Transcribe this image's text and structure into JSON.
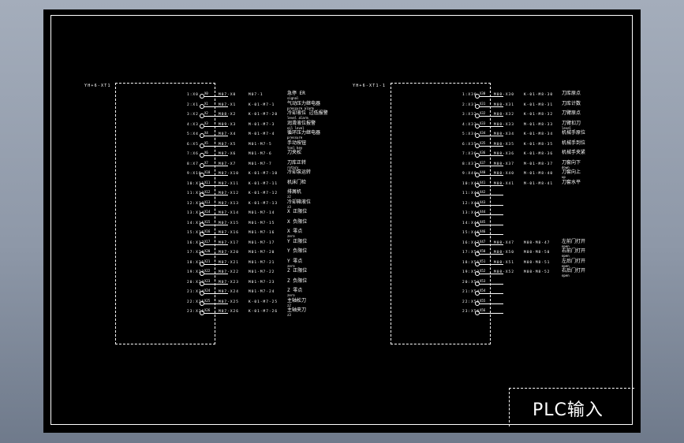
{
  "title_block": {
    "label": "PLC输入"
  },
  "left_panel": {
    "title": "YH+6-XT1",
    "rows": [
      {
        "t": "1:X0",
        "p": "X0",
        "a": "M07-X0",
        "c": "M07-1",
        "d": "急停 ER",
        "d2": "signal"
      },
      {
        "t": "2:X1",
        "p": "X1",
        "a": "M07-X1",
        "c": "K-01-M7-1",
        "d": "气动压力继电器",
        "d2": "pressure alarm"
      },
      {
        "t": "3:X2",
        "p": "X2",
        "a": "M08-X2",
        "c": "K-01-M7-20",
        "d": "冷却液位 过低报警",
        "d2": "level alarm"
      },
      {
        "t": "4:X3",
        "p": "X3",
        "a": "M09-X3",
        "c": "M-01-M7-3",
        "d": "润滑液位报警",
        "d2": "oil level"
      },
      {
        "t": "5:X4",
        "p": "X4",
        "a": "M07-X4",
        "c": "M-01-M7-4",
        "d": "循环压力继电器",
        "d2": "pressure"
      },
      {
        "t": "6:X5",
        "p": "X5",
        "a": "M07-X5",
        "c": "M01-M7-5",
        "d": "手动按钮",
        "d2": "tool key"
      },
      {
        "t": "7:X6",
        "p": "X6",
        "a": "M07-X6",
        "c": "M01-M7-6",
        "d": "刀夹松",
        "d2": ""
      },
      {
        "t": "8:X7",
        "p": "X7",
        "a": "M07-X7",
        "c": "M01-M7-7",
        "d": "刀库正转",
        "d2": "rotary"
      },
      {
        "t": "9:X10",
        "p": "X10",
        "a": "M07-X10",
        "c": "K-01-M7-10",
        "d": "冷却泵运转",
        "d2": ""
      },
      {
        "t": "10:X11",
        "p": "X11",
        "a": "M07-X11",
        "c": "K-01-M7-11",
        "d": "机床门检",
        "d2": ""
      },
      {
        "t": "11:X12",
        "p": "X12",
        "a": "M07-X12",
        "c": "K-01-M7-12",
        "d": "排屑机",
        "d2": "z2"
      },
      {
        "t": "12:X13",
        "p": "X13",
        "a": "M07-X13",
        "c": "K-01-M7-13",
        "d": "冷却箱液位",
        "d2": "z3"
      },
      {
        "t": "13:X14",
        "p": "X14",
        "a": "M07-X14",
        "c": "M01-M7-14",
        "d": "X 正限位",
        "d2": ""
      },
      {
        "t": "14:X15",
        "p": "X15",
        "a": "M07-X15",
        "c": "M01-M7-15",
        "d": "X 负限位",
        "d2": ""
      },
      {
        "t": "15:X16",
        "p": "X16",
        "a": "M07-X16",
        "c": "M01-M7-16",
        "d": "X 零点",
        "d2": "zero"
      },
      {
        "t": "16:X17",
        "p": "X17",
        "a": "M07-X17",
        "c": "M01-M7-17",
        "d": "Y 正限位",
        "d2": ""
      },
      {
        "t": "17:X20",
        "p": "X20",
        "a": "M07-X20",
        "c": "M01-M7-20",
        "d": "Y 负限位",
        "d2": ""
      },
      {
        "t": "18:X21",
        "p": "X21",
        "a": "M07-X21",
        "c": "M01-M7-21",
        "d": "Y 零点",
        "d2": "zero"
      },
      {
        "t": "19:X22",
        "p": "X22",
        "a": "M07-X22",
        "c": "M01-M7-22",
        "d": "Z 正限位",
        "d2": ""
      },
      {
        "t": "20:X23",
        "p": "X23",
        "a": "M07-X23",
        "c": "M01-M7-23",
        "d": "Z 负限位",
        "d2": ""
      },
      {
        "t": "21:X24",
        "p": "X24",
        "a": "M07-X24",
        "c": "M01-M7-24",
        "d": "Z 零点",
        "d2": "zero"
      },
      {
        "t": "22:X25",
        "p": "X25",
        "a": "M07-X25",
        "c": "K-01-M7-25",
        "d": "主轴松刀",
        "d2": "z2"
      },
      {
        "t": "23:X26",
        "p": "X26",
        "a": "M07-X26",
        "c": "K-01-M7-26",
        "d": "主轴夹刀",
        "d2": "z3"
      }
    ]
  },
  "right_panel": {
    "title": "YH+6-XT1-1",
    "rows": [
      {
        "t": "1:X30",
        "p": "X30",
        "a": "M08-X30",
        "c": "K-01-M8-30",
        "d": "刀库原点",
        "d2": ""
      },
      {
        "t": "2:X31",
        "p": "X31",
        "a": "M08-X31",
        "c": "K-01-M8-31",
        "d": "刀库计数",
        "d2": ""
      },
      {
        "t": "3:X32",
        "p": "X32",
        "a": "M08-X32",
        "c": "K-01-M8-32",
        "d": "刀臂原点",
        "d2": ""
      },
      {
        "t": "4:X33",
        "p": "X33",
        "a": "M08-X33",
        "c": "M-01-M8-33",
        "d": "刀臂扣刀",
        "d2": "level"
      },
      {
        "t": "5:X34",
        "p": "X34",
        "a": "M08-X34",
        "c": "K-01-M8-34",
        "d": "机械手原位",
        "d2": ""
      },
      {
        "t": "6:X35",
        "p": "X35",
        "a": "M08-X35",
        "c": "K-01-M8-35",
        "d": "机械手到位",
        "d2": ""
      },
      {
        "t": "7:X36",
        "p": "X36",
        "a": "M08-X36",
        "c": "K-01-M8-36",
        "d": "机械手夹紧",
        "d2": ""
      },
      {
        "t": "8:X37",
        "p": "X37",
        "a": "M08-X37",
        "c": "M-01-M8-37",
        "d": "刀套向下",
        "d2": "down"
      },
      {
        "t": "9:X40",
        "p": "X40",
        "a": "M08-X40",
        "c": "M-01-M8-40",
        "d": "刀套向上",
        "d2": "up"
      },
      {
        "t": "10:X41",
        "p": "X41",
        "a": "M08-X41",
        "c": "M-01-M8-41",
        "d": "刀套水平",
        "d2": ""
      },
      {
        "t": "11:X42",
        "p": "X42",
        "a": "",
        "c": "",
        "d": "",
        "d2": ""
      },
      {
        "t": "12:X43",
        "p": "X43",
        "a": "",
        "c": "",
        "d": "",
        "d2": ""
      },
      {
        "t": "13:X44",
        "p": "X44",
        "a": "",
        "c": "",
        "d": "",
        "d2": ""
      },
      {
        "t": "14:X45",
        "p": "X45",
        "a": "",
        "c": "",
        "d": "",
        "d2": ""
      },
      {
        "t": "15:X46",
        "p": "X46",
        "a": "",
        "c": "",
        "d": "",
        "d2": ""
      },
      {
        "t": "16:X47",
        "p": "X47",
        "a": "M08-X47",
        "c": "M08-M8-47",
        "d": "左前门打开",
        "d2": "open"
      },
      {
        "t": "17:X50",
        "p": "X50",
        "a": "M08-X50",
        "c": "M08-M8-50",
        "d": "右前门打开",
        "d2": "open"
      },
      {
        "t": "18:X51",
        "p": "X51",
        "a": "M08-X51",
        "c": "M08-M8-51",
        "d": "左后门打开",
        "d2": "open"
      },
      {
        "t": "19:X52",
        "p": "X52",
        "a": "M08-X52",
        "c": "M08-M8-52",
        "d": "右后门打开",
        "d2": "open"
      },
      {
        "t": "20:X53",
        "p": "X53",
        "a": "",
        "c": "",
        "d": "",
        "d2": ""
      },
      {
        "t": "21:X54",
        "p": "X54",
        "a": "",
        "c": "",
        "d": "",
        "d2": ""
      },
      {
        "t": "22:X55",
        "p": "X55",
        "a": "",
        "c": "",
        "d": "",
        "d2": ""
      },
      {
        "t": "23:X56",
        "p": "X56",
        "a": "",
        "c": "",
        "d": "",
        "d2": ""
      }
    ]
  }
}
